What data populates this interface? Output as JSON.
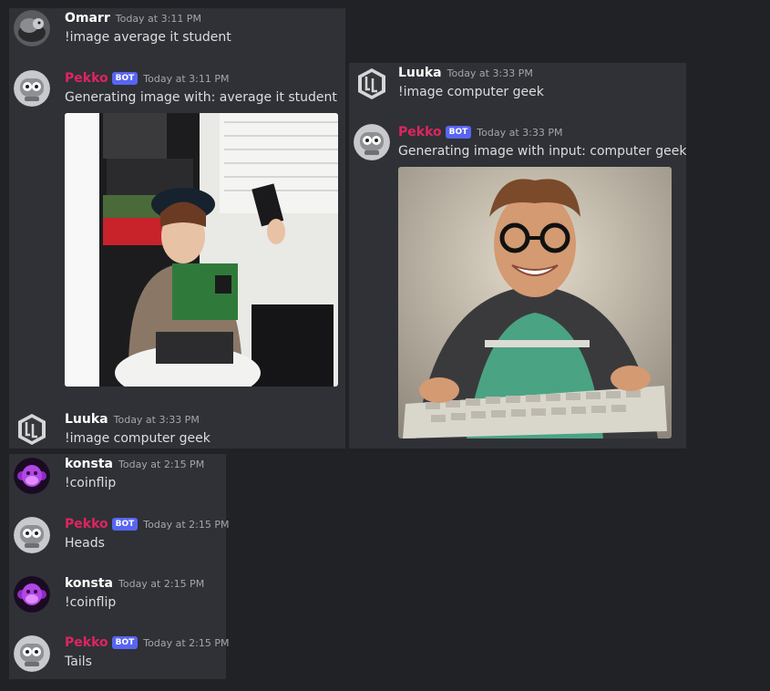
{
  "panel_a": {
    "m1": {
      "author": "Omarr",
      "time": "Today at 3:11 PM",
      "text": "!image average it student"
    },
    "m2": {
      "author": "Pekko",
      "badge": "BOT",
      "time": "Today at 3:11 PM",
      "text": "Generating image with: average it student"
    },
    "m3": {
      "author": "Luuka",
      "time": "Today at 3:33 PM",
      "text": "!image computer geek"
    }
  },
  "panel_b": {
    "m1": {
      "author": "Luuka",
      "time": "Today at 3:33 PM",
      "text": "!image computer geek"
    },
    "m2": {
      "author": "Pekko",
      "badge": "BOT",
      "time": "Today at 3:33 PM",
      "text": "Generating image with input: computer geek"
    }
  },
  "panel_c": {
    "m1": {
      "author": "konsta",
      "time": "Today at 2:15 PM",
      "text": "!coinflip"
    },
    "m2": {
      "author": "Pekko",
      "badge": "BOT",
      "time": "Today at 2:15 PM",
      "text": "Heads"
    },
    "m3": {
      "author": "konsta",
      "time": "Today at 2:15 PM",
      "text": "!coinflip"
    },
    "m4": {
      "author": "Pekko",
      "badge": "BOT",
      "time": "Today at 2:15 PM",
      "text": "Tails"
    }
  },
  "colors": {
    "background": "#202225",
    "panel": "#2f3136",
    "bot_name": "#e0245e",
    "bot_badge": "#5865f2",
    "text": "#dcddde",
    "timestamp": "#a3a6aa"
  }
}
